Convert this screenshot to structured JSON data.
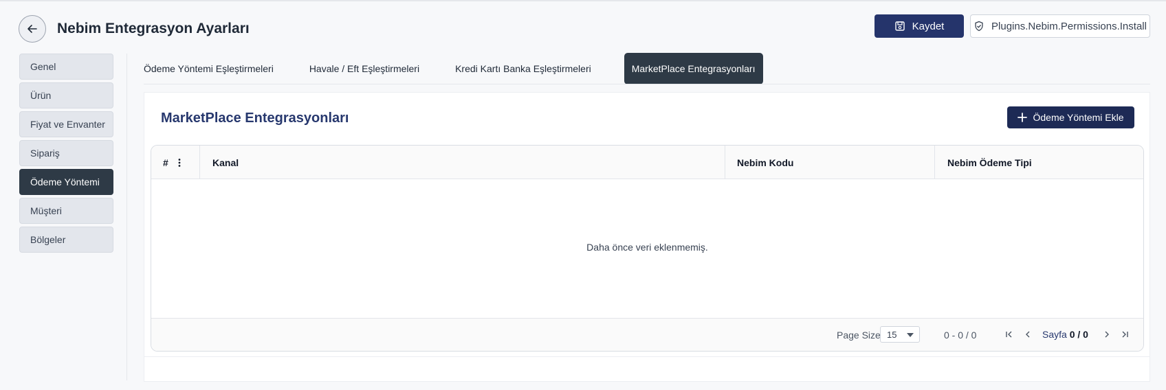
{
  "header": {
    "title": "Nebim Entegrasyon Ayarları",
    "save_label": "Kaydet",
    "permission_label": "Plugins.Nebim.Permissions.Install"
  },
  "sidebar": {
    "items": [
      {
        "label": "Genel"
      },
      {
        "label": "Ürün"
      },
      {
        "label": "Fiyat ve Envanter"
      },
      {
        "label": "Sipariş"
      },
      {
        "label": "Ödeme Yöntemi",
        "active": true
      },
      {
        "label": "Müşteri"
      },
      {
        "label": "Bölgeler"
      }
    ]
  },
  "tabs": [
    {
      "label": "Ödeme Yöntemi Eşleştirmeleri"
    },
    {
      "label": "Havale / Eft Eşleştirmeleri"
    },
    {
      "label": "Kredi Kartı Banka Eşleştirmeleri"
    },
    {
      "label": "MarketPlace Entegrasyonları",
      "active": true
    }
  ],
  "section": {
    "title": "MarketPlace Entegrasyonları",
    "add_label": "Ödeme Yöntemi Ekle"
  },
  "grid": {
    "columns": [
      "#",
      "Kanal",
      "Nebim Kodu",
      "Nebim Ödeme Tipi"
    ],
    "empty_message": "Daha önce veri eklenmemiş.",
    "footer": {
      "page_size_label": "Page Size:",
      "page_size_value": "15",
      "range": "0 - 0 / 0",
      "page_label": "Sayfa",
      "page_current": "0",
      "page_sep": "/",
      "page_total": "0"
    }
  },
  "colors": {
    "primary": "#25346b",
    "dark": "#2e3a46",
    "title": "#27386e"
  }
}
